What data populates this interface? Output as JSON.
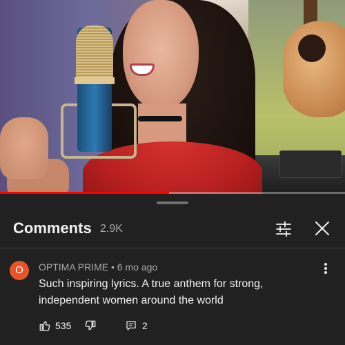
{
  "video": {
    "progress_fraction": 0.49
  },
  "comments_sheet": {
    "title": "Comments",
    "count": "2.9K",
    "filter_icon": "tune-icon",
    "close_icon": "close-icon"
  },
  "comment": {
    "avatar_letter": "O",
    "avatar_color": "#e8542a",
    "meta": "OPTIMA PRIME • 6 mo ago",
    "text": "Such inspiring lyrics.  A true anthem for strong, independent women around the world",
    "likes": "535",
    "replies": "2",
    "icons": [
      "thumbs-up-icon",
      "thumbs-down-icon",
      "reply-icon",
      "more-vert-icon"
    ]
  },
  "colors": {
    "background": "#212121",
    "text_primary": "#f1f1f1",
    "text_secondary": "#aaaaaa",
    "progress": "#ff0000"
  }
}
